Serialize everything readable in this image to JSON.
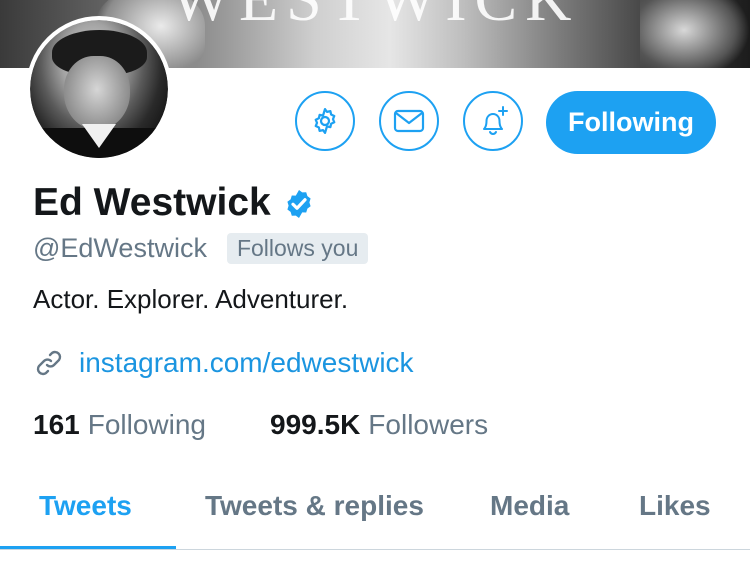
{
  "banner": {
    "text": "WESTWICK"
  },
  "profile": {
    "name": "Ed Westwick",
    "handle": "@EdWestwick",
    "follows_you": "Follows you",
    "bio": "Actor. Explorer. Adventurer.",
    "website": "instagram.com/edwestwick",
    "verified": true
  },
  "actions": {
    "settings_icon": "gear-icon",
    "message_icon": "envelope-icon",
    "notify_icon": "bell-plus-icon",
    "follow_label": "Following"
  },
  "stats": {
    "following_count": "161",
    "following_label": "Following",
    "followers_count": "999.5K",
    "followers_label": "Followers"
  },
  "tabs": [
    {
      "label": "Tweets",
      "active": true
    },
    {
      "label": "Tweets & replies",
      "active": false
    },
    {
      "label": "Media",
      "active": false
    },
    {
      "label": "Likes",
      "active": false
    }
  ],
  "colors": {
    "accent": "#1da1f2",
    "link": "#1b95e0",
    "muted": "#657786",
    "text": "#14171a",
    "badge_bg": "#e6ecf0"
  }
}
